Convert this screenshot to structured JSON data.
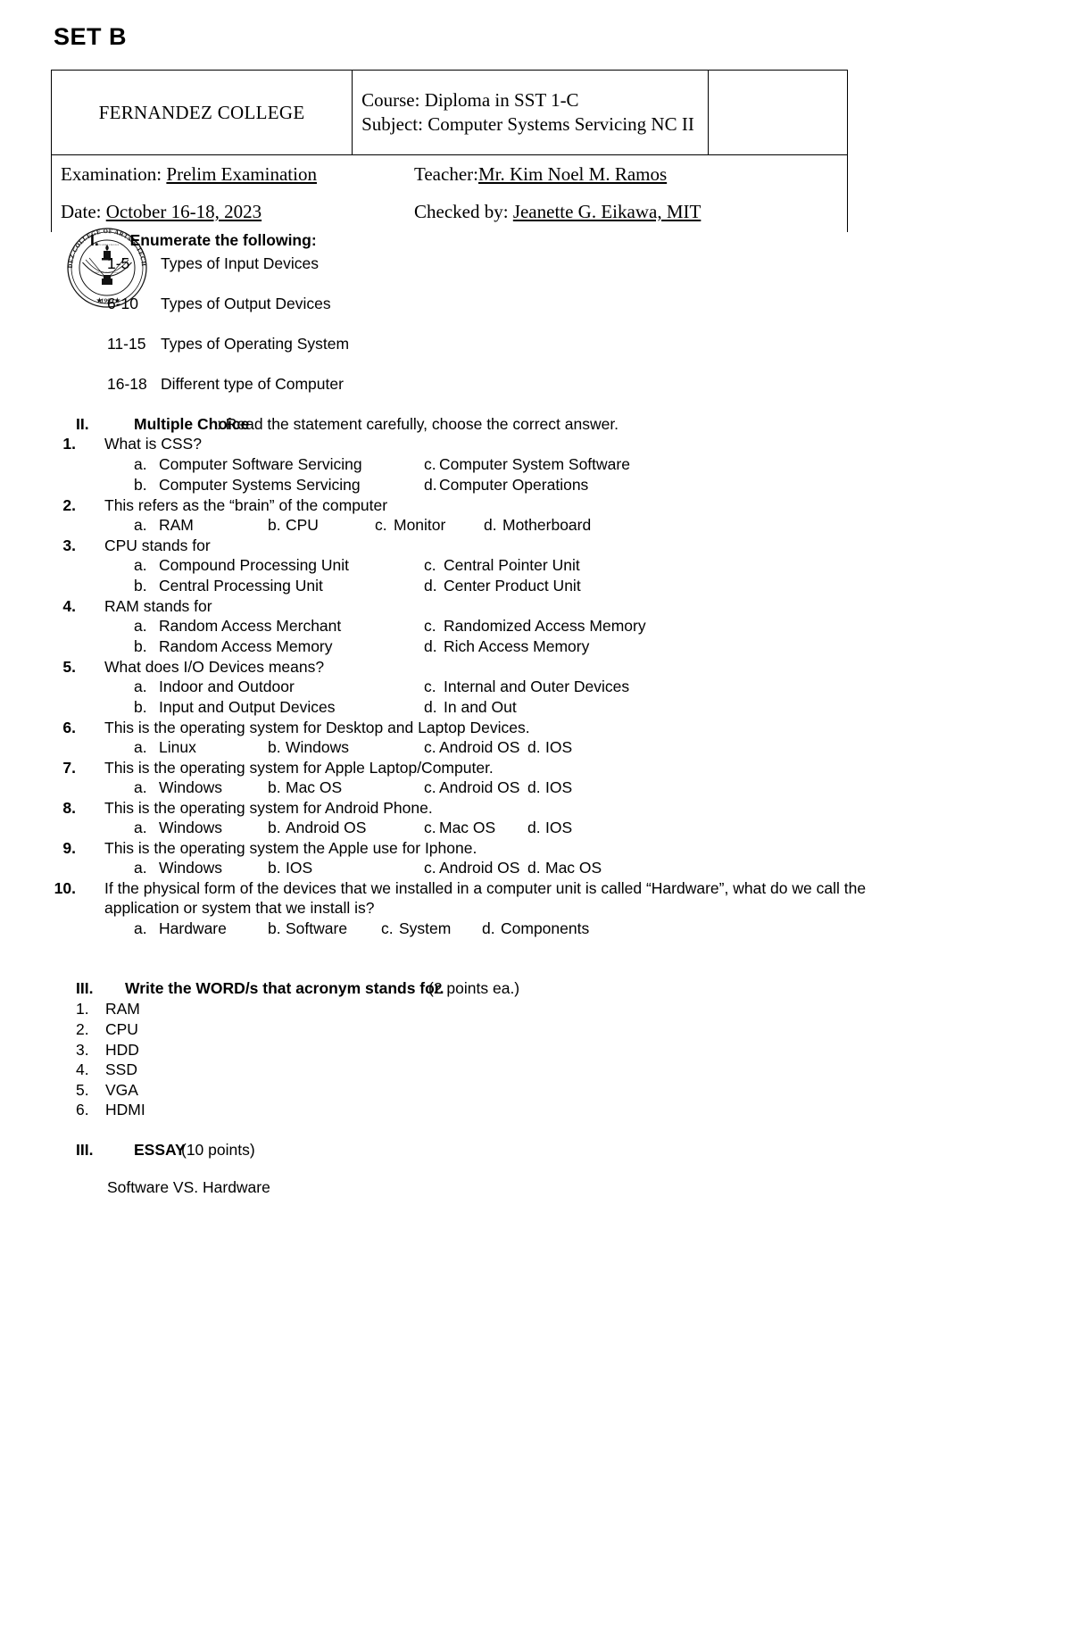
{
  "document": {
    "set_label": "SET B"
  },
  "header": {
    "college_name": "FERNANDEZ COLLEGE",
    "course_label": "Course:",
    "course_value": "Diploma in SST 1-C",
    "subject_label": "Subject:",
    "subject_value": "Computer Systems Servicing NC II",
    "examination_label": "Examination:",
    "examination_value": "Prelim Examination",
    "teacher_label": "Teacher:",
    "teacher_value": "Mr. Kim Noel M. Ramos",
    "date_label": "Date:",
    "date_value": "October 16-18, 2023",
    "checked_by_label": "Checked by:",
    "checked_by_value": "Jeanette G. Eikawa, MIT",
    "blank_cell": ""
  },
  "logo": {
    "name": "fernandez-college-seal",
    "ring_text": "FERNANDEZ COLLEGE OF ARTS & TECHNOLOGY",
    "year": "1993"
  },
  "section_1": {
    "numeral": "I.",
    "title": "Enumerate the following:",
    "items": [
      {
        "range": "1-5",
        "text": "Types of Input Devices"
      },
      {
        "range": "6-10",
        "text": "Types of Output Devices"
      },
      {
        "range": "11-15",
        "text": "Types of Operating System"
      },
      {
        "range": "16-18",
        "text": "Different type of Computer"
      }
    ]
  },
  "section_2": {
    "numeral": "II.",
    "title": "Multiple Choice",
    "instruction": ":  Read the statement carefully, choose the correct answer.",
    "questions": [
      {
        "number": "1.",
        "text": "What is CSS?",
        "layout": "two-column",
        "options": [
          {
            "letter": "a.",
            "text": "Computer Software Servicing"
          },
          {
            "letter": "b.",
            "text": "Computer Systems Servicing"
          },
          {
            "letter": "c.",
            "text": "Computer System Software"
          },
          {
            "letter": "d.",
            "text": "Computer Operations"
          }
        ]
      },
      {
        "number": "2.",
        "text": "This refers as the “brain” of the computer",
        "layout": "one-row",
        "options": [
          {
            "letter": "a.",
            "text": "RAM"
          },
          {
            "letter": "b.",
            "text": "CPU"
          },
          {
            "letter": "c.",
            "text": "Monitor"
          },
          {
            "letter": "d.",
            "text": "Motherboard"
          }
        ]
      },
      {
        "number": "3.",
        "text": "CPU stands for",
        "layout": "two-column",
        "options": [
          {
            "letter": "a.",
            "text": "Compound Processing Unit"
          },
          {
            "letter": "b.",
            "text": "Central Processing Unit"
          },
          {
            "letter": "c.",
            "text": "Central Pointer Unit"
          },
          {
            "letter": "d.",
            "text": "Center Product Unit"
          }
        ]
      },
      {
        "number": "4.",
        "text": "RAM stands for",
        "layout": "two-column",
        "options": [
          {
            "letter": "a.",
            "text": "Random Access Merchant"
          },
          {
            "letter": "b.",
            "text": "Random Access Memory"
          },
          {
            "letter": "c.",
            "text": "Randomized Access Memory"
          },
          {
            "letter": "d.",
            "text": "Rich Access Memory"
          }
        ]
      },
      {
        "number": "5.",
        "text": "What does I/O Devices means?",
        "layout": "two-column",
        "options": [
          {
            "letter": "a.",
            "text": "Indoor and Outdoor"
          },
          {
            "letter": "b.",
            "text": "Input and Output Devices"
          },
          {
            "letter": "c.",
            "text": "Internal and Outer Devices"
          },
          {
            "letter": "d.",
            "text": "In and Out"
          }
        ]
      },
      {
        "number": "6.",
        "text": "This is the operating system for Desktop and Laptop Devices.",
        "layout": "one-row",
        "options": [
          {
            "letter": "a.",
            "text": "Linux"
          },
          {
            "letter": "b.",
            "text": "Windows"
          },
          {
            "letter": "c.",
            "text": "Android OS"
          },
          {
            "letter": "d.",
            "text": "IOS"
          }
        ]
      },
      {
        "number": "7.",
        "text": "This is the operating system for Apple Laptop/Computer.",
        "layout": "one-row",
        "options": [
          {
            "letter": "a.",
            "text": "Windows"
          },
          {
            "letter": "b.",
            "text": "Mac OS"
          },
          {
            "letter": "c.",
            "text": "Android OS"
          },
          {
            "letter": "d.",
            "text": "IOS"
          }
        ]
      },
      {
        "number": "8.",
        "text": "This is the operating system for Android Phone.",
        "layout": "one-row",
        "options": [
          {
            "letter": "a.",
            "text": "Windows"
          },
          {
            "letter": "b.",
            "text": "Android OS"
          },
          {
            "letter": "c.",
            "text": "Mac OS"
          },
          {
            "letter": "d.",
            "text": "IOS"
          }
        ]
      },
      {
        "number": "9.",
        "text": "This is the operating system the Apple use for Iphone.",
        "layout": "one-row",
        "options": [
          {
            "letter": "a.",
            "text": "Windows"
          },
          {
            "letter": "b.",
            "text": "IOS"
          },
          {
            "letter": "c.",
            "text": "Android OS"
          },
          {
            "letter": "d.",
            "text": "Mac OS"
          }
        ]
      },
      {
        "number": "10.",
        "text": "If the physical form of the devices that we installed in a computer unit is called “Hardware”, what do we call the application or system that we install is?",
        "layout": "one-row",
        "options": [
          {
            "letter": "a.",
            "text": "Hardware"
          },
          {
            "letter": "b.",
            "text": "Software"
          },
          {
            "letter": "c.",
            "text": "System"
          },
          {
            "letter": "d.",
            "text": "Components"
          }
        ]
      }
    ]
  },
  "section_3": {
    "numeral": "III.",
    "title": "Write the WORD/s that acronym stands for.",
    "points_note": "(2 points ea.)",
    "items": [
      {
        "number": "1.",
        "text": "RAM"
      },
      {
        "number": "2.",
        "text": "CPU"
      },
      {
        "number": "3.",
        "text": "HDD"
      },
      {
        "number": "4.",
        "text": "SSD"
      },
      {
        "number": "5.",
        "text": "VGA"
      },
      {
        "number": "6.",
        "text": "HDMI"
      }
    ]
  },
  "section_4": {
    "numeral": "III.",
    "title": "ESSAY",
    "points_note": "(10 points)",
    "topic": "Software VS. Hardware"
  }
}
